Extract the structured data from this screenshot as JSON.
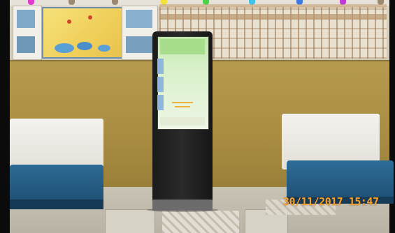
{
  "photo": {
    "kind": "photograph",
    "timestamp_overlay": "30/11/2017 15:47"
  },
  "colors": {
    "wall": "#a88c42",
    "sofa_seat": "#1f4f73",
    "sofa_back": "#f0eee9",
    "kiosk": "#1b1b1b",
    "kiosk_screen": "#d7f0c8",
    "timestamp": "#f2a332"
  },
  "icons": [
    "kiosk-icon",
    "sofa-icon",
    "poster-icon"
  ]
}
